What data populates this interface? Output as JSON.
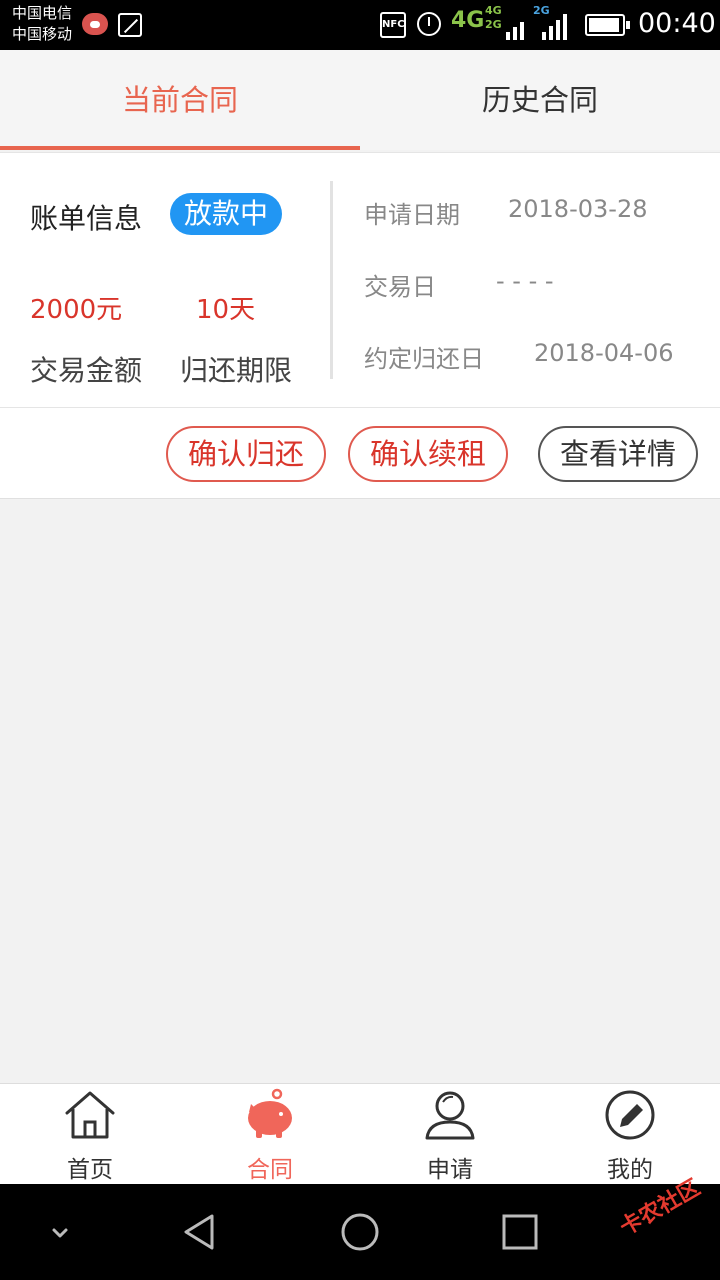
{
  "status_bar": {
    "carrier1": "中国电信",
    "carrier2": "中国移动",
    "nfc": "NFC",
    "net_4g": "4G",
    "net_4g_small": "4G",
    "net_2g_small": "2G",
    "net_2g_b": "2G",
    "time": "00:40"
  },
  "tabs": [
    {
      "label": "当前合同",
      "active": true
    },
    {
      "label": "历史合同",
      "active": false
    }
  ],
  "contract": {
    "title": "账单信息",
    "status": "放款中",
    "status_color": "#2196f3",
    "amount": "2000元",
    "term": "10天",
    "amount_label": "交易金额",
    "term_label": "归还期限",
    "apply_date_label": "申请日期",
    "apply_date": "2018-03-28",
    "trade_date_label": "交易日",
    "trade_date": "- - - -",
    "due_date_label": "约定归还日",
    "due_date": "2018-04-06"
  },
  "actions": {
    "confirm_return": "确认归还",
    "confirm_renew": "确认续租",
    "view_details": "查看详情"
  },
  "bottom_nav": [
    {
      "label": "首页",
      "icon": "home-icon",
      "active": false
    },
    {
      "label": "合同",
      "icon": "piggy-bank-icon",
      "active": true
    },
    {
      "label": "申请",
      "icon": "user-icon",
      "active": false
    },
    {
      "label": "我的",
      "icon": "edit-icon",
      "active": false
    }
  ],
  "colors": {
    "accent": "#e8654f",
    "danger_text": "#d9352b",
    "badge_blue": "#2196f3"
  },
  "watermark": "卡农社区"
}
